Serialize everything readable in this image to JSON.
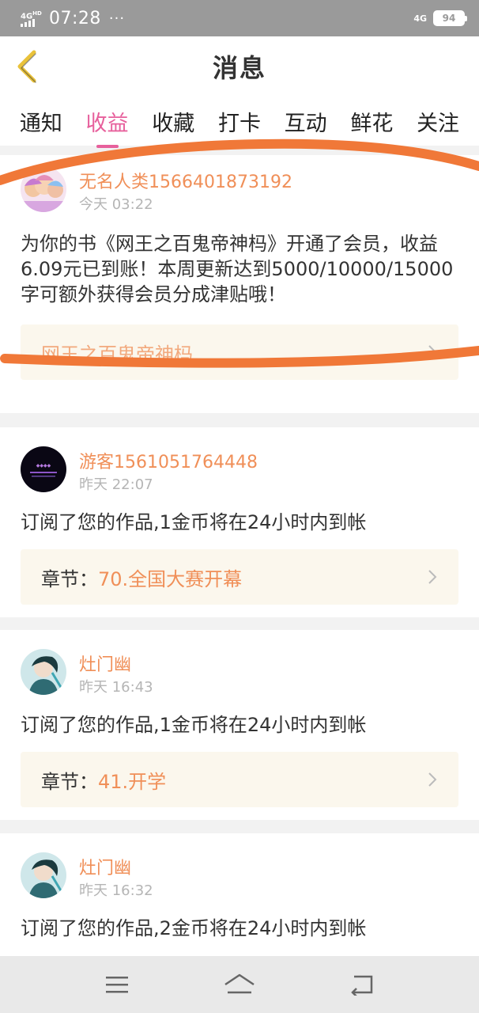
{
  "status_bar": {
    "network_left": "4G",
    "network_left_sup": "HD",
    "time": "07:28",
    "dots": "···",
    "network_right": "4G",
    "battery": "94"
  },
  "header": {
    "title": "消息",
    "back_icon": "chevron-left-icon"
  },
  "tabs": [
    {
      "label": "通知",
      "active": false
    },
    {
      "label": "收益",
      "active": true
    },
    {
      "label": "收藏",
      "active": false
    },
    {
      "label": "打卡",
      "active": false
    },
    {
      "label": "互动",
      "active": false
    },
    {
      "label": "鲜花",
      "active": false
    },
    {
      "label": "关注",
      "active": false
    }
  ],
  "messages": [
    {
      "username": "无名人类1566401873192",
      "time": "今天 03:22",
      "text": "为你的书《网王之百鬼帝神杩》开通了会员，收益6.09元已到账！本周更新达到5000/10000/15000字可额外获得会员分成津贴哦！",
      "link_text": "网王之百鬼帝神杩"
    },
    {
      "username": "游客1561051764448",
      "time": "昨天 22:07",
      "text": "订阅了您的作品,1金币将在24小时内到帐",
      "chapter_label": "章节：",
      "chapter_name": "70.全国大赛开幕"
    },
    {
      "username": "灶门幽",
      "time": "昨天 16:43",
      "text": "订阅了您的作品,1金币将在24小时内到帐",
      "chapter_label": "章节：",
      "chapter_name": "41.开学"
    },
    {
      "username": "灶门幽",
      "time": "昨天 16:32",
      "text": "订阅了您的作品,2金币将在24小时内到帐"
    }
  ],
  "colors": {
    "accent": "#e7609c",
    "username": "#f08f58",
    "annotation_stroke": "#f07838"
  }
}
